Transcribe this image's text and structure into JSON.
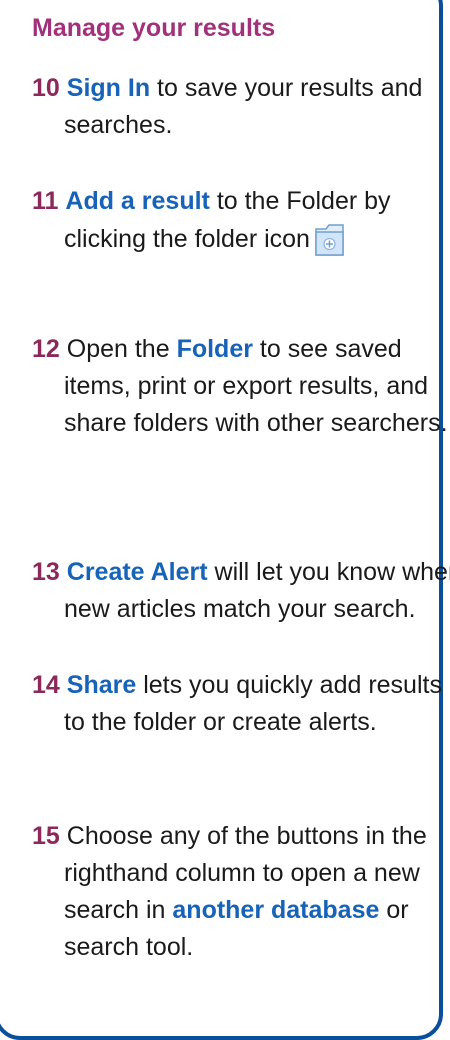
{
  "heading": "Manage your results",
  "items": [
    {
      "num": "10",
      "key": "Sign In",
      "pre": "",
      "post": " to save your results and searches."
    },
    {
      "num": "11",
      "key": "Add a result",
      "pre": "",
      "post": " to the Folder by clicking the folder icon"
    },
    {
      "num": "12",
      "key": "Folder",
      "pre": " Open the ",
      "post": " to see saved items, print or export results, and share folders with other searchers."
    },
    {
      "num": "13",
      "key": "Create Alert",
      "pre": "",
      "post": " will let you know when new articles match your search."
    },
    {
      "num": "14",
      "key": "Share",
      "pre": "",
      "post": " lets you quickly add results to the folder or create alerts."
    },
    {
      "num": "15",
      "key": "another database",
      "pre": " Choose any of the buttons in the righthand column to open a new search in ",
      "post": " or search tool."
    }
  ],
  "icons": {
    "folder": "folder-add-icon"
  },
  "colors": {
    "border": "#0b4f9c",
    "heading": "#a0317a",
    "number": "#8b2a5a",
    "keyword": "#1663b8"
  }
}
